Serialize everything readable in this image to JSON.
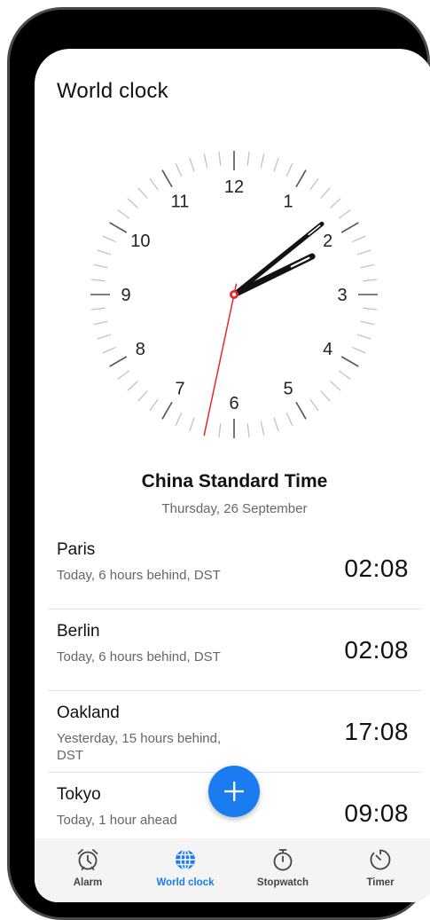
{
  "page": {
    "title": "World clock"
  },
  "clock": {
    "numerals": [
      "12",
      "1",
      "2",
      "3",
      "4",
      "5",
      "6",
      "7",
      "8",
      "9",
      "10",
      "11"
    ],
    "hour": 14,
    "minute": 8,
    "second": 32,
    "accent_color": "#e8262e"
  },
  "home_zone": {
    "name": "China Standard Time",
    "date": "Thursday, 26 September"
  },
  "cities": [
    {
      "name": "Paris",
      "offset": "Today, 6 hours behind, DST",
      "time": "02:08"
    },
    {
      "name": "Berlin",
      "offset": "Today, 6 hours behind, DST",
      "time": "02:08"
    },
    {
      "name": "Oakland",
      "offset": "Yesterday, 15 hours behind, DST",
      "time": "17:08"
    },
    {
      "name": "Tokyo",
      "offset": "Today, 1 hour ahead",
      "time": "09:08"
    }
  ],
  "fab": {
    "icon": "plus-icon",
    "color": "#1a7cf0"
  },
  "tabs": [
    {
      "label": "Alarm",
      "icon": "alarm-clock-icon",
      "active": false
    },
    {
      "label": "World clock",
      "icon": "globe-icon",
      "active": true
    },
    {
      "label": "Stopwatch",
      "icon": "stopwatch-icon",
      "active": false
    },
    {
      "label": "Timer",
      "icon": "timer-icon",
      "active": false
    }
  ],
  "colors": {
    "accent": "#1a7cf0",
    "tab_bar_bg": "#f4f4f4"
  }
}
